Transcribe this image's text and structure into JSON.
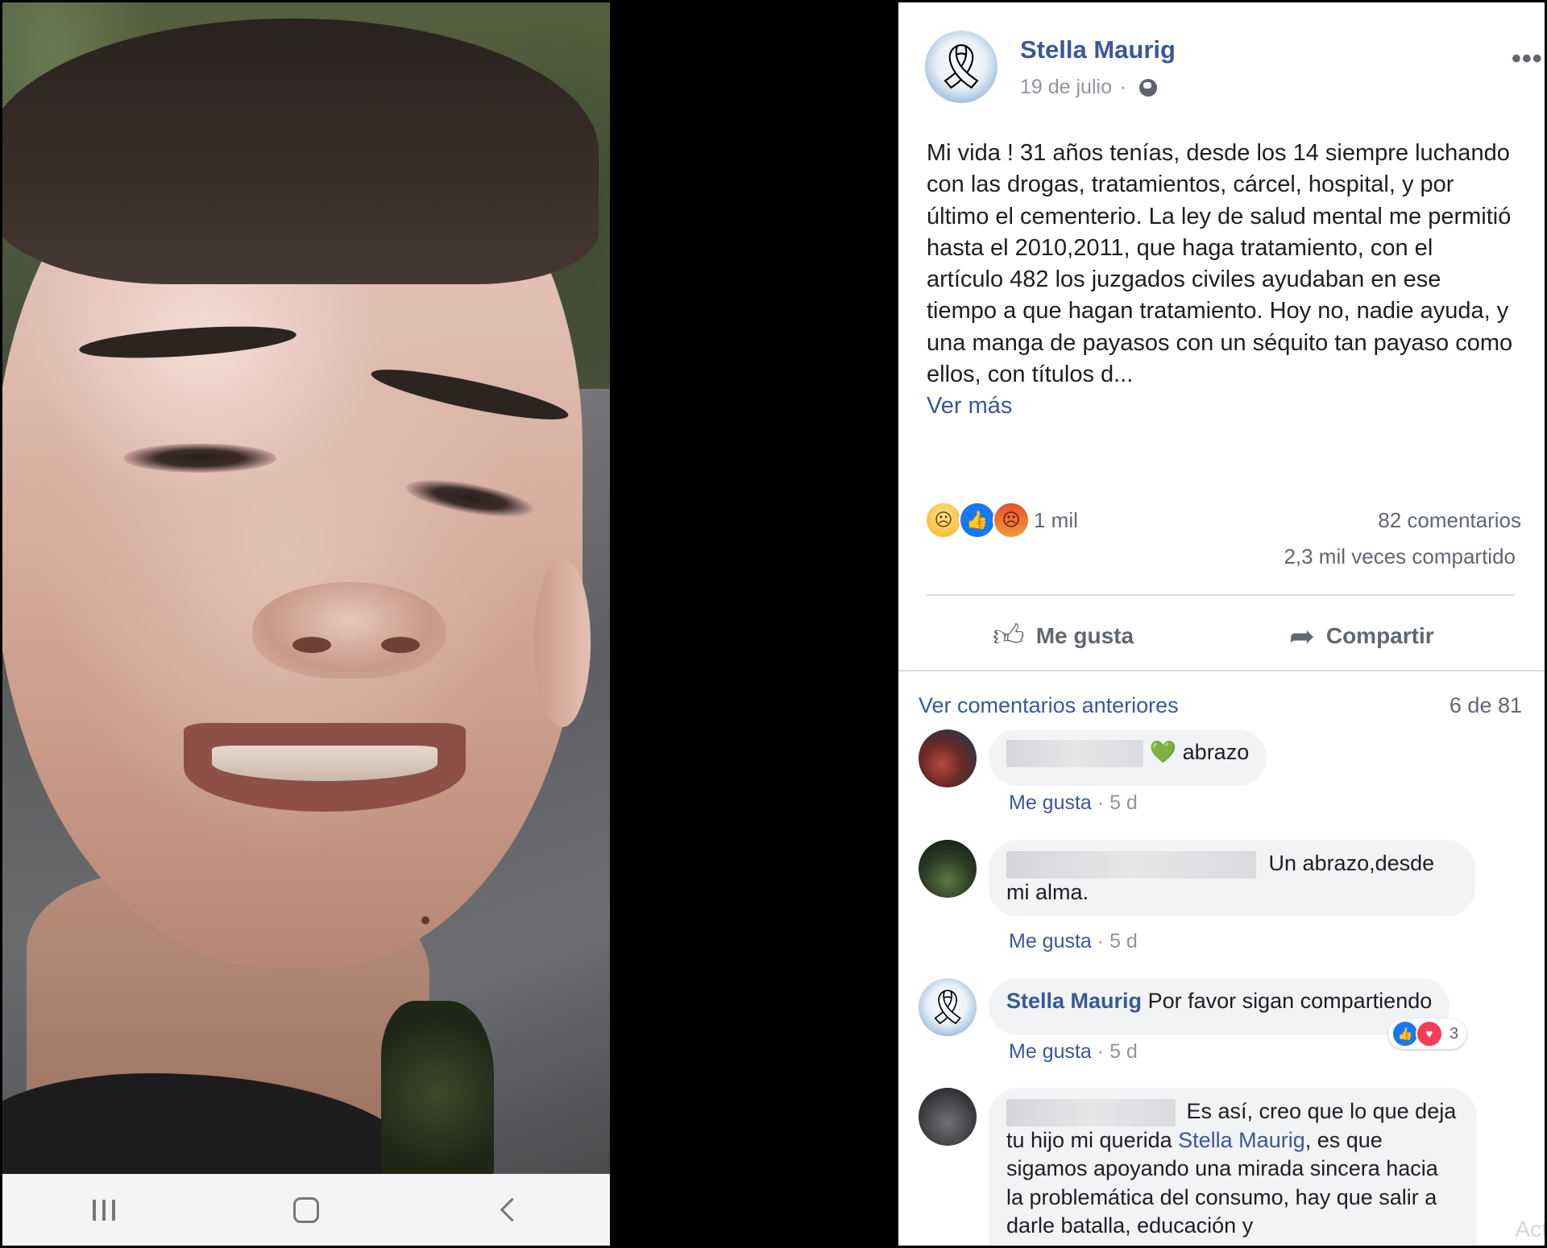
{
  "phone": {
    "nav_icons": [
      "recent-apps-icon",
      "home-icon",
      "back-icon"
    ]
  },
  "post": {
    "author": "Stella Maurig",
    "date": "19 de julio",
    "separator": "·",
    "audience_icon": "globe-icon",
    "more_label": "•••",
    "body": "Mi vida ! 31 años tenías, desde los 14 siempre luchando con las drogas, tratamientos, cárcel, hospital, y por último el cementerio. La ley de salud mental me permitió hasta el 2010,2011, que haga tratamiento, con el artículo 482 los juzgados civiles ayudaban en ese tiempo a que hagan tratamiento. Hoy no, nadie ayuda, y una manga de payasos con un séquito tan payaso como ellos, con títulos d...",
    "see_more": "Ver más",
    "reactions": [
      "sad",
      "like",
      "angry"
    ],
    "reaction_count": "1 mil",
    "comments_count": "82 comentarios",
    "shares_count": "2,3 mil veces compartido",
    "like_button": "Me gusta",
    "share_button": "Compartir"
  },
  "comments_section": {
    "previous_link": "Ver comentarios anteriores",
    "page_indicator": "6 de 81",
    "like_label": "Me gusta",
    "dot": "·",
    "items": [
      {
        "text_emoji": "💚",
        "text": "abrazo",
        "time": "5 d"
      },
      {
        "text": "Un abrazo,desde mi alma.",
        "time": "5 d"
      },
      {
        "author": "Stella Maurig",
        "text": "Por favor sigan compartiendo",
        "time": "5 d",
        "reaction_count": "3",
        "reactions": [
          "like",
          "love"
        ]
      },
      {
        "text_start": "Es así, creo que lo que deja tu hijo mi querida",
        "mention": "Stella Maurig",
        "text_end": ", es que sigamos apoyando una mirada sincera hacia la problemática del consumo, hay que salir a darle batalla, educación y"
      }
    ]
  },
  "watermark": "Act",
  "colors": {
    "link": "#385898",
    "meta": "#90949c",
    "bubble": "#f2f3f5",
    "like_blue": "#1877f2",
    "love_red": "#f33e58"
  }
}
